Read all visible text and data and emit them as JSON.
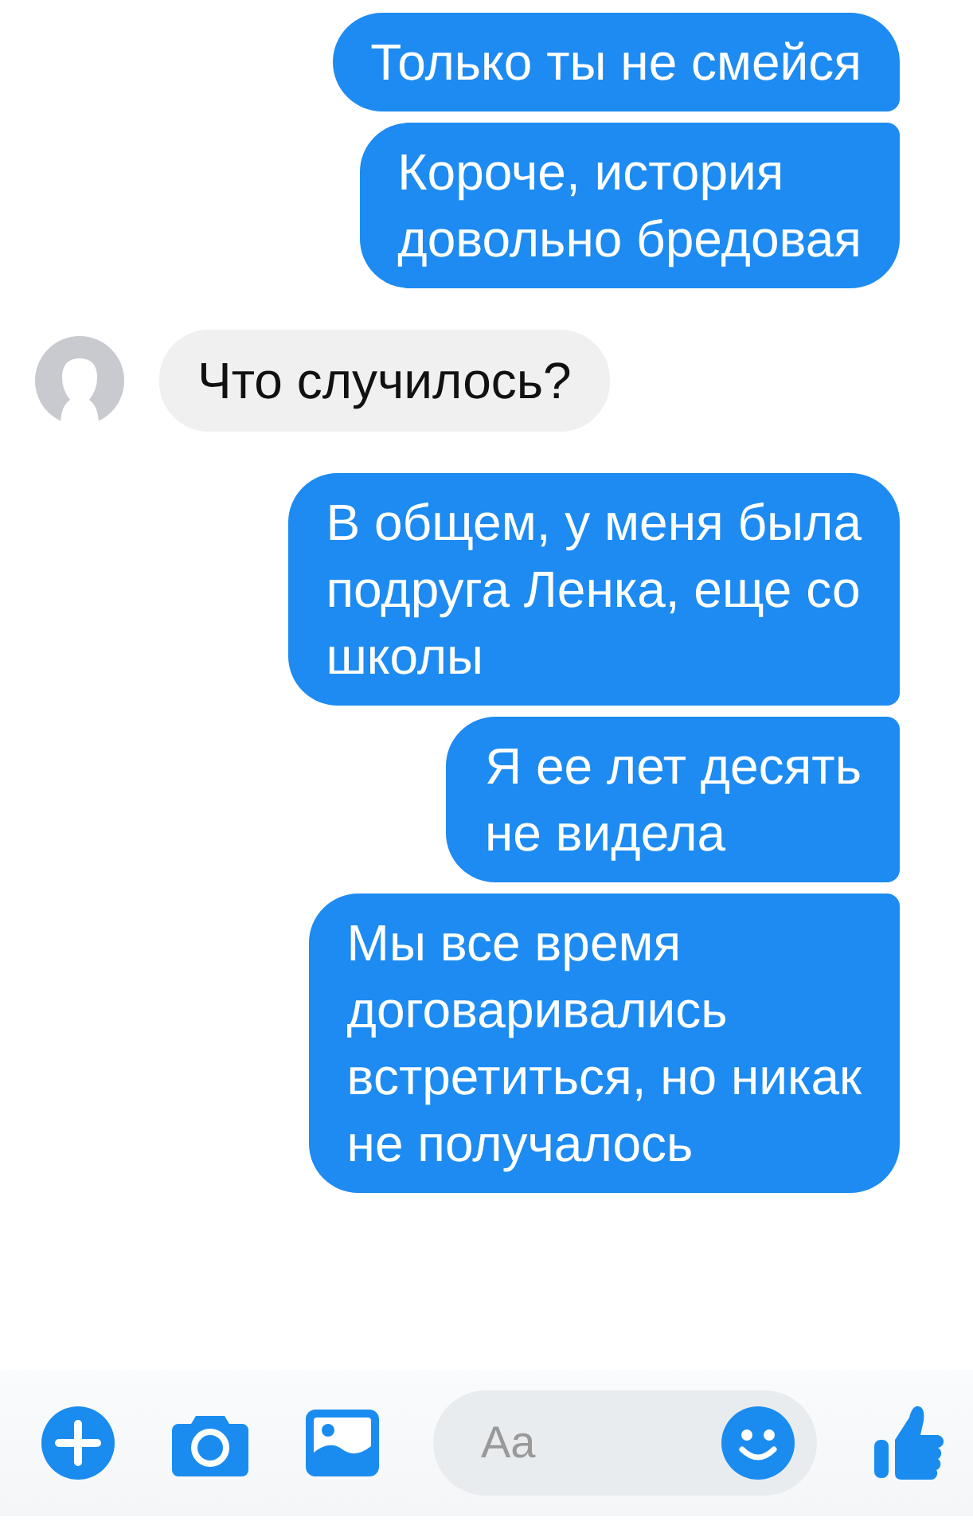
{
  "messages": [
    {
      "kind": "sent",
      "text": "Только ты не смейся"
    },
    {
      "kind": "sent",
      "text": "Короче, история\nдовольно бредовая"
    },
    {
      "kind": "received",
      "text": "Что случилось?"
    },
    {
      "kind": "sent",
      "text": "В общем, у меня была\nподруга Ленка, еще со\nшколы"
    },
    {
      "kind": "sent",
      "text": "Я ее лет десять\nне видела"
    },
    {
      "kind": "sent",
      "text": "Мы все время\nдоговаривались\nвстретиться, но никак\nне получалось"
    }
  ],
  "composer": {
    "placeholder": "Aa"
  }
}
